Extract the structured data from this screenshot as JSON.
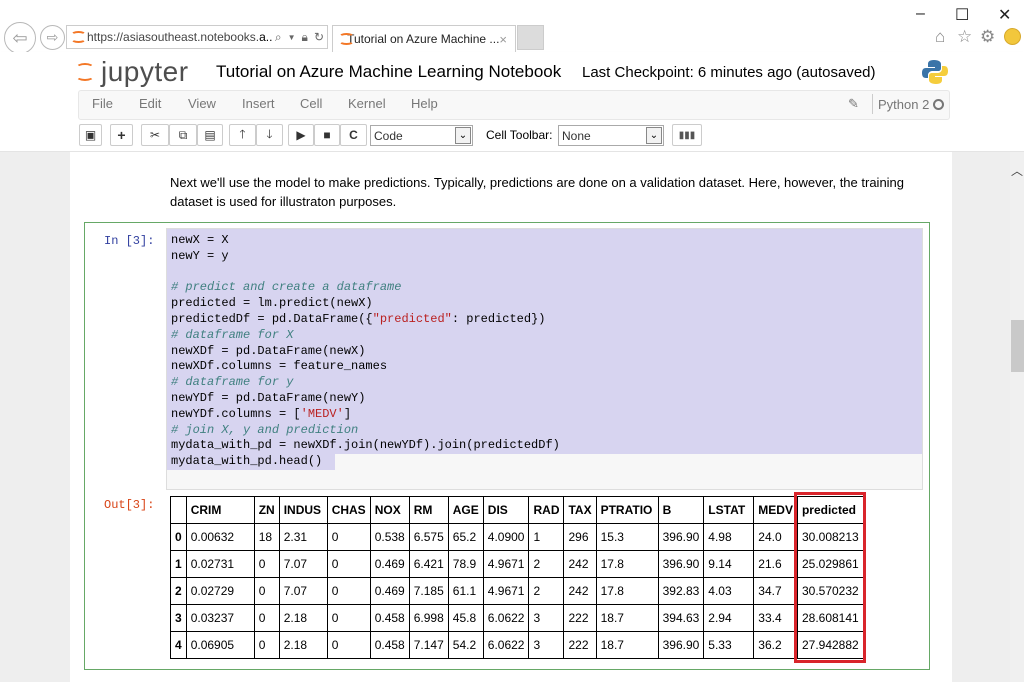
{
  "browser": {
    "address": {
      "url_prefix": "https://asiasoutheast.notebooks.",
      "url_bold": "a..",
      "search_icon": "search-icon",
      "lock_icon": "lock-icon",
      "refresh_icon": "refresh-icon"
    },
    "tab": {
      "title": "Tutorial on Azure Machine ...",
      "close": "×"
    },
    "window": {
      "minimize": "–",
      "maximize": "☐",
      "close": "✕"
    },
    "toolbar_icons": {
      "home": "⌂",
      "favorites": "☆",
      "settings": "⚙"
    }
  },
  "notebook": {
    "logo_text": "jupyter",
    "title": "Tutorial on Azure Machine Learning Notebook",
    "checkpoint": "Last Checkpoint: 6 minutes ago (autosaved)",
    "menu": [
      "File",
      "Edit",
      "View",
      "Insert",
      "Cell",
      "Kernel",
      "Help"
    ],
    "kernel_name": "Python 2",
    "cell_type": "Code",
    "cell_toolbar_label": "Cell Toolbar:",
    "cell_toolbar_value": "None"
  },
  "markdown": "Next we'll use the model to make predictions. Typically, predictions are done on a validation dataset. Here, however, the training dataset is used for illustraton purposes.",
  "cell": {
    "in_prompt": "In [3]:",
    "out_prompt": "Out[3]:",
    "code_lines": [
      {
        "t": "code",
        "s": "newX = X"
      },
      {
        "t": "code",
        "s": "newY = y"
      },
      {
        "t": "code",
        "s": ""
      },
      {
        "t": "cm",
        "s": "# predict and create a dataframe"
      },
      {
        "t": "code",
        "s": "predicted = lm.predict(newX)"
      },
      {
        "t": "mix",
        "a": "predictedDf = pd.DataFrame({",
        "b": "\"predicted\"",
        "c": ": predicted})"
      },
      {
        "t": "cm",
        "s": "# dataframe for X"
      },
      {
        "t": "code",
        "s": "newXDf = pd.DataFrame(newX)"
      },
      {
        "t": "code",
        "s": "newXDf.columns = feature_names"
      },
      {
        "t": "cm",
        "s": "# dataframe for y"
      },
      {
        "t": "code",
        "s": "newYDf = pd.DataFrame(newY)"
      },
      {
        "t": "mix",
        "a": "newYDf.columns = [",
        "b": "'MEDV'",
        "c": "]"
      },
      {
        "t": "cm",
        "s": "# join X, y and prediction"
      },
      {
        "t": "code",
        "s": "mydata_with_pd = newXDf.join(newYDf).join(predictedDf)"
      },
      {
        "t": "code",
        "s": "mydata_with_pd.head()"
      }
    ]
  },
  "table": {
    "columns": [
      "",
      "CRIM",
      "ZN",
      "INDUS",
      "CHAS",
      "NOX",
      "RM",
      "AGE",
      "DIS",
      "RAD",
      "TAX",
      "PTRATIO",
      "B",
      "LSTAT",
      "MEDV",
      "predicted"
    ],
    "rows": [
      [
        "0",
        "0.00632",
        "18",
        "2.31",
        "0",
        "0.538",
        "6.575",
        "65.2",
        "4.0900",
        "1",
        "296",
        "15.3",
        "396.90",
        "4.98",
        "24.0",
        "30.008213"
      ],
      [
        "1",
        "0.02731",
        "0",
        "7.07",
        "0",
        "0.469",
        "6.421",
        "78.9",
        "4.9671",
        "2",
        "242",
        "17.8",
        "396.90",
        "9.14",
        "21.6",
        "25.029861"
      ],
      [
        "2",
        "0.02729",
        "0",
        "7.07",
        "0",
        "0.469",
        "7.185",
        "61.1",
        "4.9671",
        "2",
        "242",
        "17.8",
        "392.83",
        "4.03",
        "34.7",
        "30.570232"
      ],
      [
        "3",
        "0.03237",
        "0",
        "2.18",
        "0",
        "0.458",
        "6.998",
        "45.8",
        "6.0622",
        "3",
        "222",
        "18.7",
        "394.63",
        "2.94",
        "33.4",
        "28.608141"
      ],
      [
        "4",
        "0.06905",
        "0",
        "2.18",
        "0",
        "0.458",
        "7.147",
        "54.2",
        "6.0622",
        "3",
        "222",
        "18.7",
        "396.90",
        "5.33",
        "36.2",
        "27.942882"
      ]
    ],
    "highlight_column": "predicted",
    "highlight_color": "#d9252b"
  },
  "colors": {
    "accent_logo": "#f37726",
    "cell_border": "#66a866",
    "selection": "#d7d4f0",
    "in_prompt": "#303f9f",
    "out_prompt": "#d84315"
  }
}
